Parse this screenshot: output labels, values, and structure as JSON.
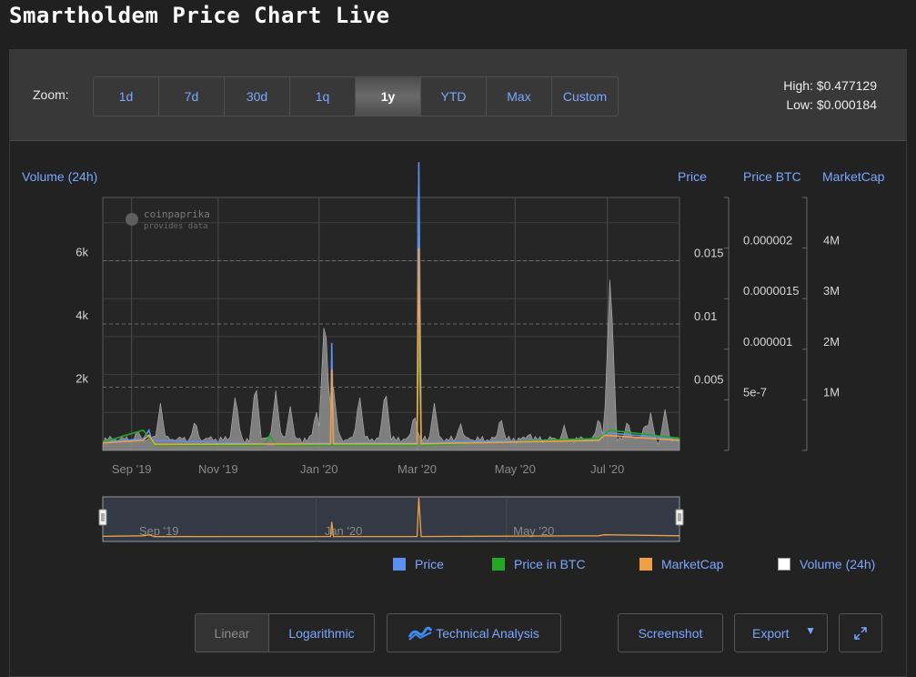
{
  "page": {
    "title": "Smartholdem Price Chart Live"
  },
  "toolbar": {
    "zoom_label": "Zoom:",
    "zoom_options": [
      "1d",
      "7d",
      "30d",
      "1q",
      "1y",
      "YTD",
      "Max",
      "Custom"
    ],
    "zoom_active": "1y",
    "high": "High: $0.477129",
    "low": "Low: $0.000184"
  },
  "axes": {
    "volume_title": "Volume (24h)",
    "price_title": "Price",
    "price_btc_title": "Price BTC",
    "marketcap_title": "MarketCap"
  },
  "watermark": {
    "line1": "coinpaprika",
    "line2": "provides data"
  },
  "colors": {
    "price": "#5b8ff0",
    "price_btc": "#23a823",
    "marketcap": "#f0a043",
    "volume": "#a0a0a0",
    "accent": "#7aa7ff"
  },
  "chart_data": {
    "type": "line",
    "x_tick_labels": [
      "Sep '19",
      "Nov '19",
      "Jan '20",
      "Mar '20",
      "May '20",
      "Jul '20"
    ],
    "axes": {
      "volume": {
        "title": "Volume (24h)",
        "ticks": [
          "2k",
          "4k",
          "6k"
        ],
        "ylim": [
          0,
          8000
        ]
      },
      "price": {
        "title": "Price",
        "ticks": [
          "0.005",
          "0.01",
          "0.015"
        ],
        "ylim": [
          0,
          0.02
        ]
      },
      "price_btc": {
        "title": "Price BTC",
        "ticks": [
          "5e-7",
          "0.000001",
          "0.0000015",
          "0.000002"
        ],
        "ylim": [
          0,
          2.5e-06
        ]
      },
      "marketcap": {
        "title": "MarketCap",
        "ticks": [
          "1M",
          "2M",
          "3M",
          "4M"
        ],
        "ylim": [
          0,
          5000000
        ]
      }
    },
    "volume_peaks": [
      {
        "t": 0.06,
        "v": 700
      },
      {
        "t": 0.1,
        "v": 1500
      },
      {
        "t": 0.16,
        "v": 1000
      },
      {
        "t": 0.23,
        "v": 1800
      },
      {
        "t": 0.265,
        "v": 2200
      },
      {
        "t": 0.3,
        "v": 1900
      },
      {
        "t": 0.325,
        "v": 1400
      },
      {
        "t": 0.37,
        "v": 1300
      },
      {
        "t": 0.385,
        "v": 4500
      },
      {
        "t": 0.4,
        "v": 2000
      },
      {
        "t": 0.445,
        "v": 1800
      },
      {
        "t": 0.49,
        "v": 2000
      },
      {
        "t": 0.54,
        "v": 1200
      },
      {
        "t": 0.575,
        "v": 1500
      },
      {
        "t": 0.62,
        "v": 900
      },
      {
        "t": 0.69,
        "v": 1100
      },
      {
        "t": 0.74,
        "v": 600
      },
      {
        "t": 0.8,
        "v": 800
      },
      {
        "t": 0.86,
        "v": 1100
      },
      {
        "t": 0.88,
        "v": 5800
      },
      {
        "t": 0.91,
        "v": 1000
      },
      {
        "t": 0.94,
        "v": 900
      },
      {
        "t": 0.95,
        "v": 1200
      },
      {
        "t": 0.975,
        "v": 1300
      }
    ],
    "series": [
      {
        "name": "Price",
        "key": "price",
        "points": [
          [
            0.0,
            0.0007
          ],
          [
            0.07,
            0.0009
          ],
          [
            0.08,
            0.0016
          ],
          [
            0.085,
            0.0008
          ],
          [
            0.3,
            0.0005
          ],
          [
            0.395,
            0.0006
          ],
          [
            0.397,
            0.0085
          ],
          [
            0.4,
            0.0006
          ],
          [
            0.545,
            0.0006
          ],
          [
            0.548,
            0.0228
          ],
          [
            0.552,
            0.0006
          ],
          [
            0.86,
            0.0009
          ],
          [
            0.87,
            0.0014
          ],
          [
            1.0,
            0.0009
          ]
        ]
      },
      {
        "name": "Price in BTC",
        "key": "price_btc",
        "points": [
          [
            0.0,
            8e-08
          ],
          [
            0.04,
            1.5e-07
          ],
          [
            0.07,
            2e-07
          ],
          [
            0.09,
            5e-08
          ],
          [
            0.28,
            5e-08
          ],
          [
            0.29,
            1.5e-07
          ],
          [
            0.3,
            5e-08
          ],
          [
            0.545,
            5e-08
          ],
          [
            0.548,
            1.2e-06
          ],
          [
            0.552,
            5e-08
          ],
          [
            0.86,
            1.2e-07
          ],
          [
            0.88,
            2e-07
          ],
          [
            1.0,
            1.2e-07
          ]
        ]
      },
      {
        "name": "MarketCap",
        "key": "marketcap",
        "points": [
          [
            0.0,
            150000
          ],
          [
            0.07,
            200000
          ],
          [
            0.08,
            300000
          ],
          [
            0.09,
            120000
          ],
          [
            0.395,
            130000
          ],
          [
            0.397,
            1600000
          ],
          [
            0.4,
            130000
          ],
          [
            0.545,
            130000
          ],
          [
            0.548,
            4000000
          ],
          [
            0.552,
            130000
          ],
          [
            0.86,
            200000
          ],
          [
            0.87,
            300000
          ],
          [
            1.0,
            200000
          ]
        ]
      }
    ]
  },
  "navigator": {
    "labels": [
      "Sep '19",
      "Jan '20",
      "May '20"
    ]
  },
  "legend": [
    {
      "label": "Price",
      "key": "price"
    },
    {
      "label": "Price in BTC",
      "key": "price_btc"
    },
    {
      "label": "MarketCap",
      "key": "marketcap"
    },
    {
      "label": "Volume (24h)",
      "key": "volume"
    }
  ],
  "controls": {
    "linear": "Linear",
    "logarithmic": "Logarithmic",
    "technical_analysis": "Technical Analysis",
    "screenshot": "Screenshot",
    "export": "Export"
  }
}
